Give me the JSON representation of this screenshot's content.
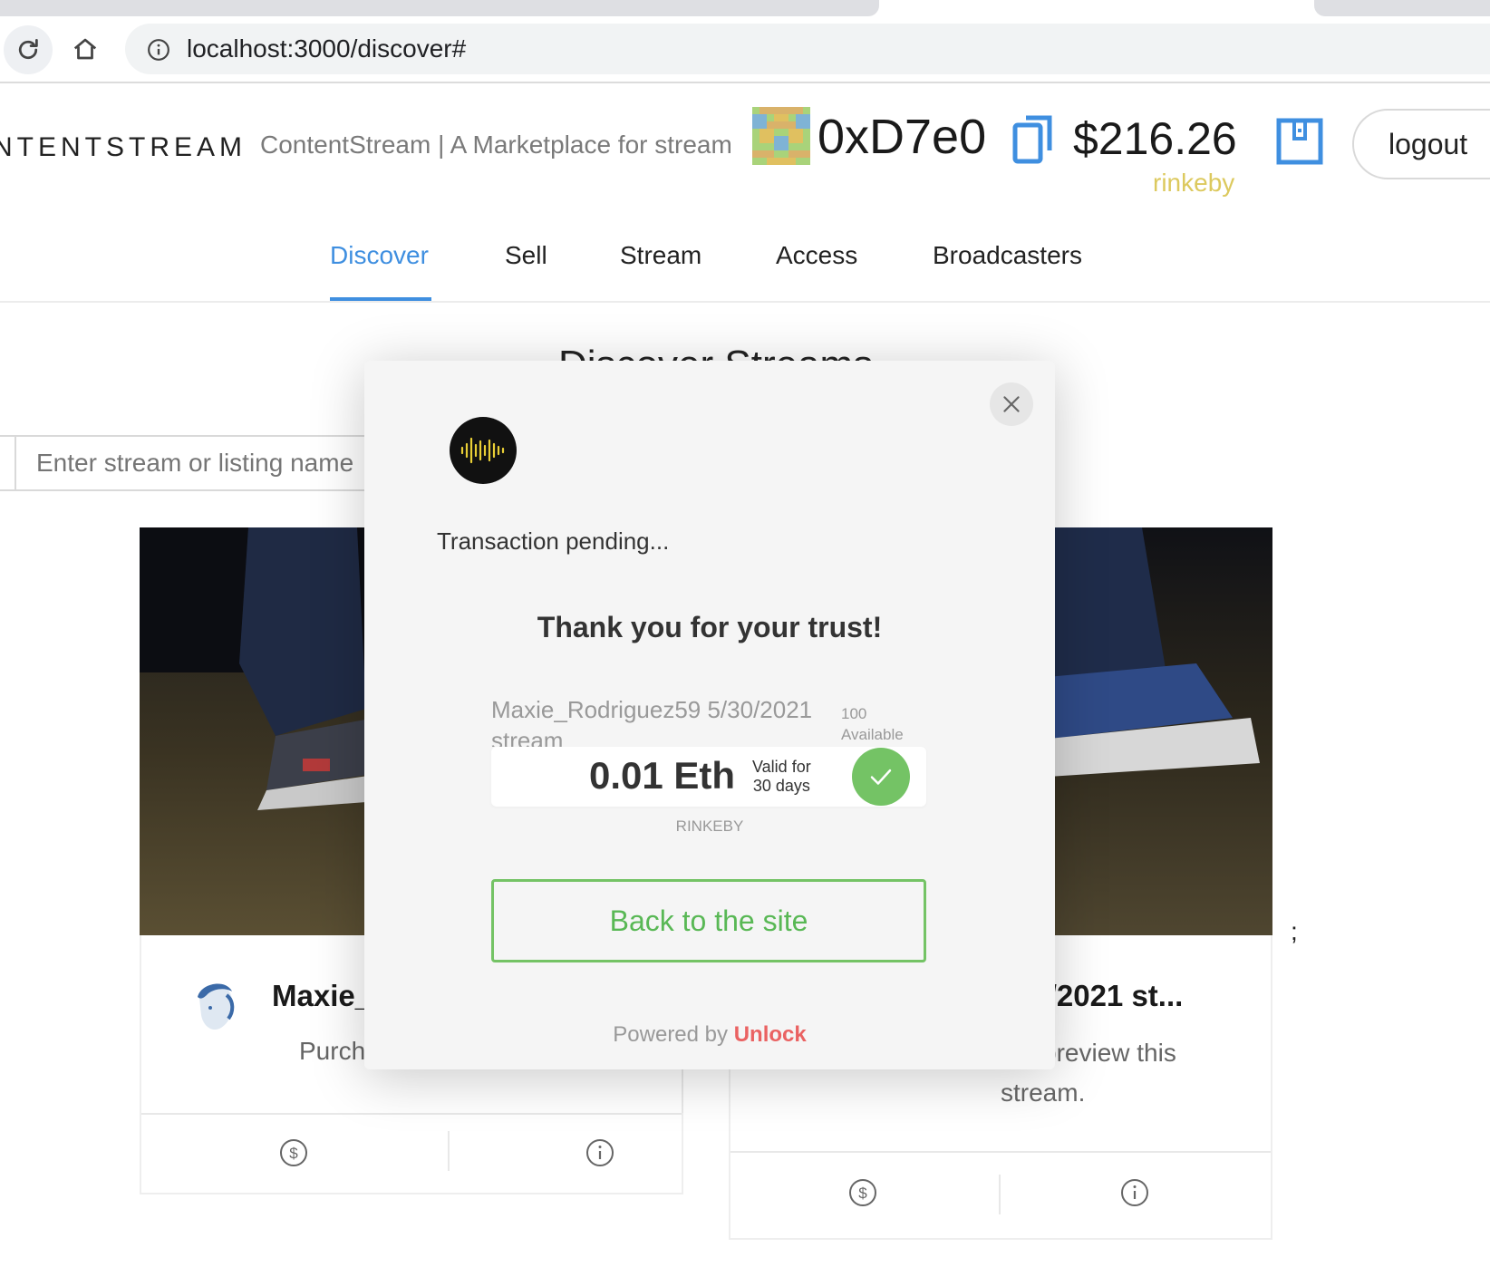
{
  "browser": {
    "url": "localhost:3000/discover#"
  },
  "header": {
    "brand": "NTENTSTREAM",
    "tagline": "ContentStream | A Marketplace for stream",
    "address": "0xD7e0",
    "balance": "$216.26",
    "network": "rinkeby",
    "logout_label": "logout"
  },
  "nav": {
    "items": [
      {
        "label": "Discover",
        "active": true
      },
      {
        "label": "Sell"
      },
      {
        "label": "Stream"
      },
      {
        "label": "Access"
      },
      {
        "label": "Broadcasters"
      }
    ]
  },
  "page": {
    "title": "Discover Streams",
    "search_placeholder": "Enter stream or listing name"
  },
  "cards": [
    {
      "title": "Maxie_",
      "description": "Purch"
    },
    {
      "title": "29/2021 st...",
      "description_line1": "preview this",
      "description_line2": "stream."
    }
  ],
  "stray_text": ";",
  "modal": {
    "status": "Transaction pending...",
    "heading": "Thank you for your trust!",
    "lock_name": "Maxie_Rodriguez59 5/30/2021 stream",
    "available_count": "100",
    "available_label": "Available",
    "price": "0.01 Eth",
    "valid_line1": "Valid for",
    "valid_line2": "30 days",
    "network": "RINKEBY",
    "back_label": "Back to the site",
    "powered_by": "Powered by",
    "powered_brand": "Unlock"
  },
  "colors": {
    "accent": "#3f8fe0",
    "network": "#dcc95e",
    "success": "#74c365",
    "unlock": "#ea6262"
  }
}
